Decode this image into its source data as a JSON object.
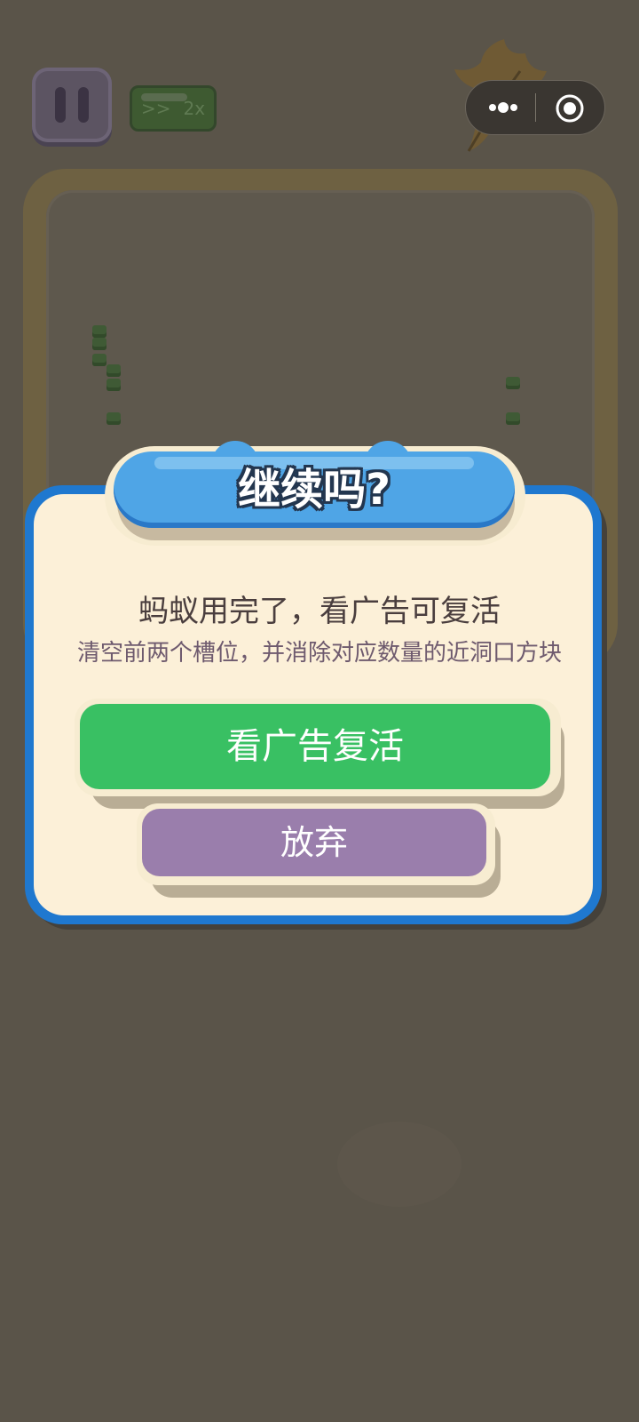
{
  "game": {
    "speed_arrows": ">>",
    "speed_label": "2x"
  },
  "dialog": {
    "title": "继续吗?",
    "message": "蚂蚁用完了，看广告可复活",
    "detail": "清空前两个槽位，并消除对应数量的近洞口方块",
    "revive_button": "看广告复活",
    "quit_button": "放弃"
  },
  "colors": {
    "dialog_border": "#1f78cf",
    "dialog_bg": "#fcf0d8",
    "title_plate": "#4fa5e6",
    "revive_button": "#39c063",
    "quit_button": "#9a7eac",
    "overlay": "#575148"
  },
  "icons": {
    "pause": "pause-icon",
    "more": "more-dots-icon",
    "close": "close-target-icon",
    "leaf": "leaf-icon"
  }
}
